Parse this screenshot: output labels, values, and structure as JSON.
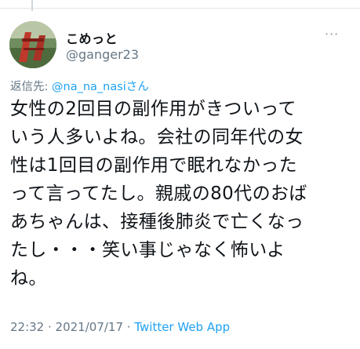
{
  "profile": {
    "display_name": "こめっと",
    "handle": "@ganger23",
    "avatar_icon": "avatar-photo"
  },
  "menu": {
    "more_label": "···"
  },
  "reply": {
    "prefix": "返信先: ",
    "mention": "@na_na_nasiさん"
  },
  "tweet": {
    "lines": [
      "女性の2回目の副作用がきついって",
      "いう人多いよね。会社の同年代の女",
      "性は1回目の副作用で眠れなかった",
      "って言ってたし。親戚の80代のおば",
      "あちゃんは、接種後肺炎で亡くなっ",
      "たし・・・笑い事じゃなく怖いよ",
      "ね。"
    ]
  },
  "meta": {
    "time": "22:32",
    "sep1": " · ",
    "date": "2021/07/17",
    "sep2": " · ",
    "app": "Twitter Web App"
  },
  "colors": {
    "link": "#1da1f2",
    "secondary": "#657786",
    "text": "#0f1419"
  }
}
